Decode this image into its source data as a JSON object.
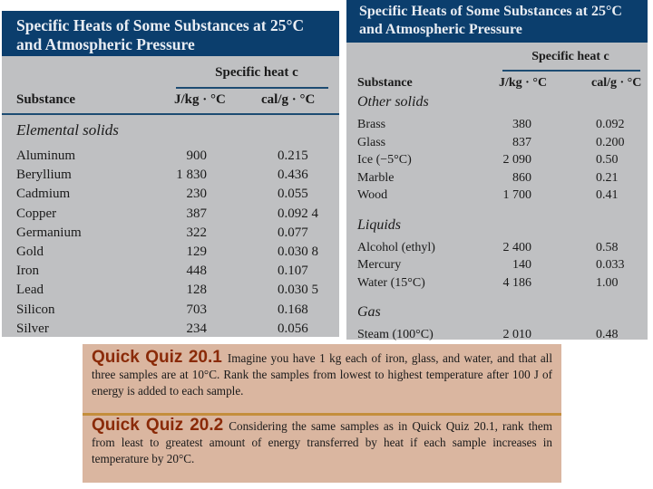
{
  "left_table": {
    "title_line1": "Specific Heats of Some Substances at 25°C",
    "title_line2": "and Atmospheric Pressure",
    "group_header": "Specific heat c",
    "col_substance": "Substance",
    "col_si": "J/kg · °C",
    "col_cal": "cal/g · °C",
    "category": "Elemental solids",
    "rows": [
      {
        "name": "Aluminum",
        "si": "900",
        "cal": "0.215"
      },
      {
        "name": "Beryllium",
        "si": "1 830",
        "cal": "0.436"
      },
      {
        "name": "Cadmium",
        "si": "230",
        "cal": "0.055"
      },
      {
        "name": "Copper",
        "si": "387",
        "cal": "0.092 4"
      },
      {
        "name": "Germanium",
        "si": "322",
        "cal": "0.077"
      },
      {
        "name": "Gold",
        "si": "129",
        "cal": "0.030 8"
      },
      {
        "name": "Iron",
        "si": "448",
        "cal": "0.107"
      },
      {
        "name": "Lead",
        "si": "128",
        "cal": "0.030 5"
      },
      {
        "name": "Silicon",
        "si": "703",
        "cal": "0.168"
      },
      {
        "name": "Silver",
        "si": "234",
        "cal": "0.056"
      }
    ]
  },
  "right_table": {
    "title_line1": "Specific Heats of Some Substances at 25°C",
    "title_line2": "and Atmospheric Pressure",
    "group_header": "Specific heat c",
    "col_substance": "Substance",
    "col_si": "J/kg · °C",
    "col_cal": "cal/g · °C",
    "categories": [
      {
        "label": "Other solids",
        "rows": [
          {
            "name": "Brass",
            "si": "380",
            "cal": "0.092"
          },
          {
            "name": "Glass",
            "si": "837",
            "cal": "0.200"
          },
          {
            "name": "Ice (−5°C)",
            "si": "2 090",
            "cal": "0.50"
          },
          {
            "name": "Marble",
            "si": "860",
            "cal": "0.21"
          },
          {
            "name": "Wood",
            "si": "1 700",
            "cal": "0.41"
          }
        ]
      },
      {
        "label": "Liquids",
        "rows": [
          {
            "name": "Alcohol (ethyl)",
            "si": "2 400",
            "cal": "0.58"
          },
          {
            "name": "Mercury",
            "si": "140",
            "cal": "0.033"
          },
          {
            "name": "Water (15°C)",
            "si": "4 186",
            "cal": "1.00"
          }
        ]
      },
      {
        "label": "Gas",
        "rows": [
          {
            "name": "Steam (100°C)",
            "si": "2 010",
            "cal": "0.48"
          }
        ]
      }
    ]
  },
  "quizzes": [
    {
      "title": "Quick Quiz 20.1",
      "text": "Imagine you have 1 kg each of iron, glass, and water, and that all three samples are at 10°C. Rank the samples from lowest to highest tempera­ture after 100 J of energy is added to each sample."
    },
    {
      "title": "Quick Quiz 20.2",
      "text": "Considering the same samples as in Quick Quiz 20.1, rank them from least to greatest amount of energy transferred by heat if each sample in­creases in temperature by 20°C."
    }
  ],
  "colors": {
    "header_bg": "#0b3e6d",
    "table_bg": "#bfc0c2",
    "quiz_bg": "#dab6a0",
    "quiz_title": "#8a2a08",
    "quiz_separator": "#c48e3c"
  }
}
